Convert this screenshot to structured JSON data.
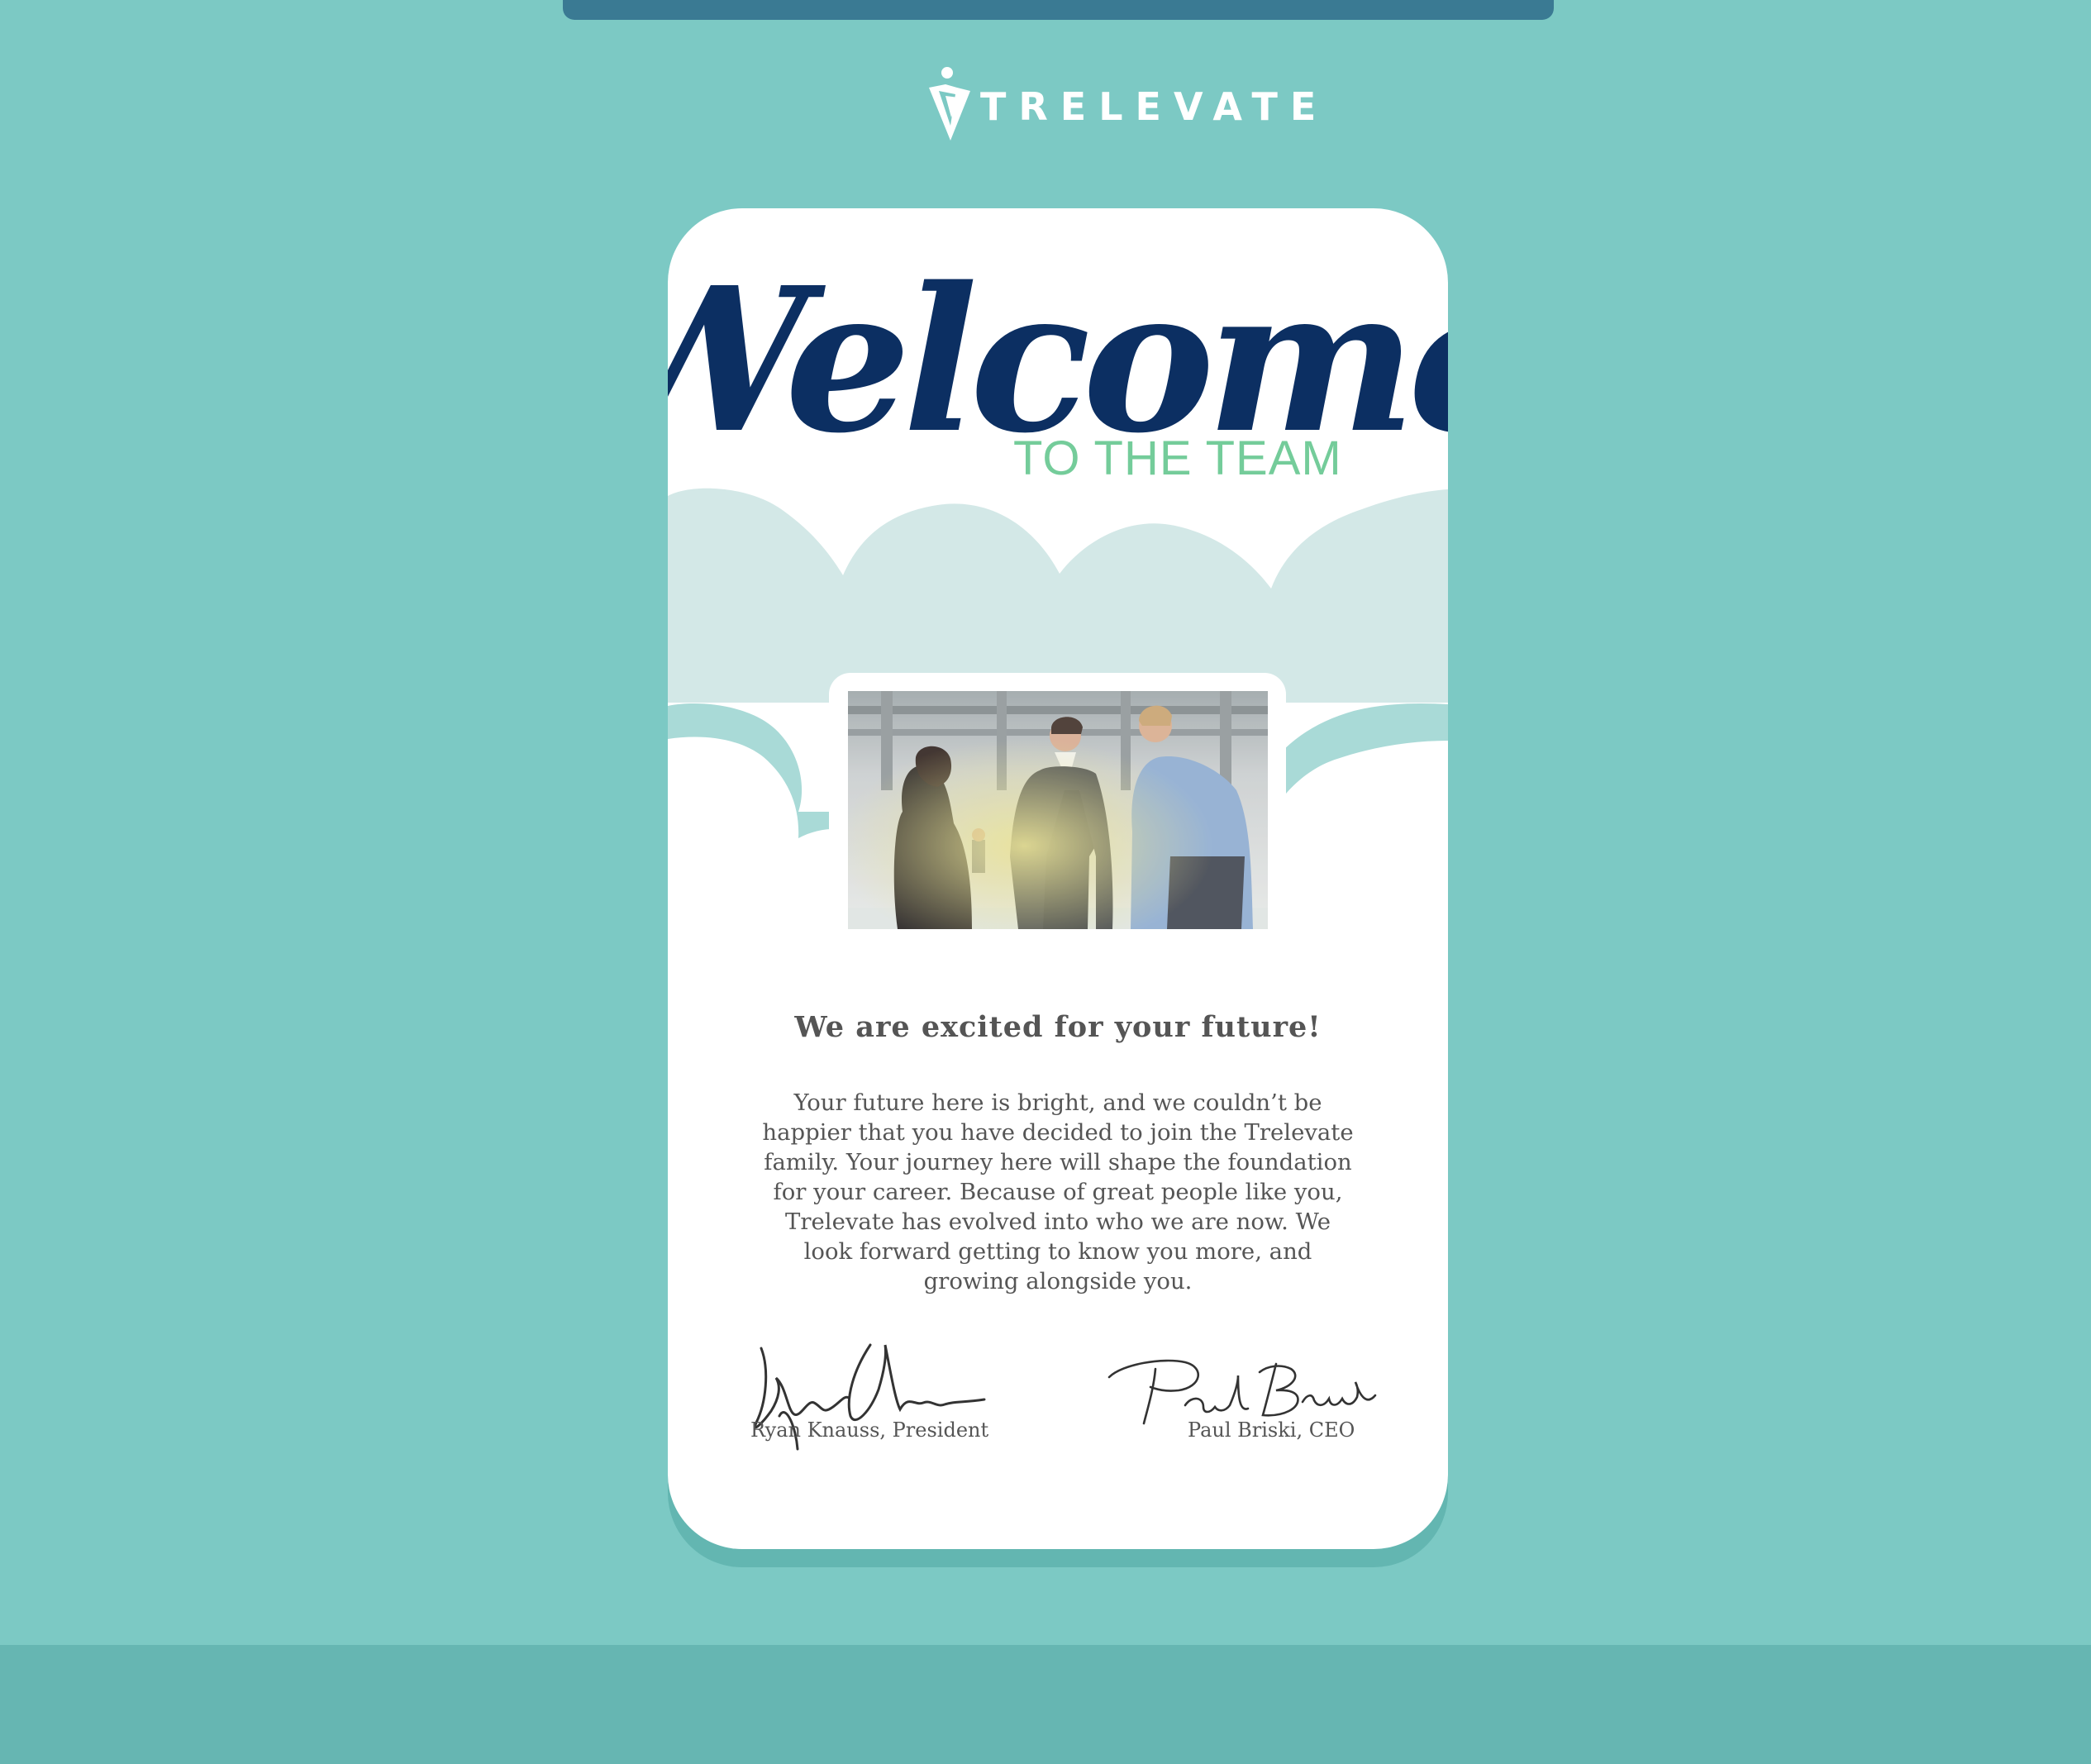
{
  "brand": {
    "logo_text": "TRELEVATE"
  },
  "card": {
    "welcome": "Welcome",
    "subtitle": "TO THE TEAM",
    "headline": "We are excited for your future!",
    "body": "Your future here is bright, and we couldn’t be happier that you have decided to join the Trelevate family. Your journey here will shape the foundation for your career. Because of great people like you, Trelevate has evolved into who we are now. We look forward getting to know you more, and growing alongside you.",
    "signatures": [
      {
        "caption": "Ryan Knauss, President"
      },
      {
        "caption": "Paul Briski, CEO"
      }
    ]
  },
  "colors": {
    "background": "#7cc9c4",
    "top_bar": "#3a7a93",
    "welcome_navy": "#0c2f62",
    "subtitle_green": "#74cc9a",
    "cloud_light": "#d3e8e7",
    "cloud_teal": "#a9dad7",
    "footer_band": "#66b6b2",
    "text_gray": "#555555"
  },
  "icons": {
    "logo_mark": "trelevate-v-icon"
  }
}
